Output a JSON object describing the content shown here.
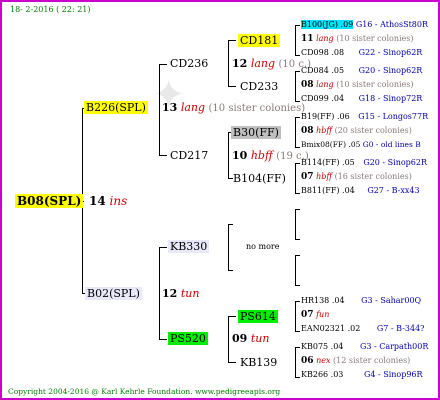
{
  "header_date": "18-  2-2016 ( 22: 21)",
  "footer": "Copyright 2004-2016 @ Karl Kehrle Foundation.   www.pedigreeapis.org",
  "root": {
    "name": "B08(SPL)",
    "year": "14",
    "race": "ins"
  },
  "sire": {
    "name": "B226(SPL)",
    "year": "13",
    "race": "lang",
    "note": "(10 sister colonies)"
  },
  "dam": {
    "name": "B02(SPL)",
    "year": "12",
    "race": "tun"
  },
  "ss": {
    "name": "CD236",
    "year": "12",
    "race": "lang",
    "note": "(10 c.)"
  },
  "sd": {
    "name": "CD217",
    "year": "10",
    "race": "hbff",
    "note": "(19 c.)"
  },
  "ds": {
    "name": "KB330",
    "text": "no more"
  },
  "dd": {
    "name": "PS520",
    "year": "09",
    "race": "tun"
  },
  "sss": {
    "name": "CD181"
  },
  "ssd": {
    "name": "CD233"
  },
  "sds": {
    "name": "B30(FF)"
  },
  "sdd": {
    "name": "B104(FF)"
  },
  "dds": {
    "name": "PS614"
  },
  "ddd": {
    "name": "KB139"
  },
  "r1": {
    "a": "B100(JG) .09",
    "b": "G16 - AthosSt80R"
  },
  "r2": {
    "year": "11",
    "race": "lang",
    "note": "(10 sister colonies)"
  },
  "r3": {
    "a": "CD098 .08",
    "b": "G22 - Sinop62R"
  },
  "r4": {
    "a": "CD084 .05",
    "b": "G20 - Sinop62R"
  },
  "r5": {
    "year": "08",
    "race": "lang",
    "note": "(10 sister colonies)"
  },
  "r6": {
    "a": "CD099 .04",
    "b": "G18 - Sinop72R"
  },
  "r7": {
    "a": "B19(FF) .06",
    "b": "G15 - Longos77R"
  },
  "r8": {
    "year": "08",
    "race": "hbff",
    "note": "(20 sister colonies)"
  },
  "r9": {
    "a": "Bmix08(FF) .05",
    "b": "G0 - old lines B"
  },
  "r10": {
    "a": "B114(FF) .05",
    "b": "G20 - Sinop62R"
  },
  "r11": {
    "year": "07",
    "race": "hbff",
    "note": "(16 sister colonies)"
  },
  "r12": {
    "a": "B811(FF) .04",
    "b": "G27 - B-xx43"
  },
  "r13": {
    "a": "HR138 .04",
    "b": "G3 - Sahar00Q"
  },
  "r14": {
    "year": "07",
    "race": "fun"
  },
  "r15": {
    "a": "EAN02321 .02",
    "b": "G7 - B-344?"
  },
  "r16": {
    "a": "KB075 .04",
    "b": "G3 - Carpath00R"
  },
  "r17": {
    "year": "06",
    "race": "nex",
    "note": "(12 sister colonies)"
  },
  "r18": {
    "a": "KB266 .03",
    "b": "G4 - Sinop96R"
  },
  "colors": {
    "frame": "#cc00cc",
    "highlight_yellow": "#ffff00",
    "highlight_cyan": "#00e5ff",
    "highlight_green": "#00ee00",
    "race": "#cc0000",
    "entry": "#0000aa"
  }
}
